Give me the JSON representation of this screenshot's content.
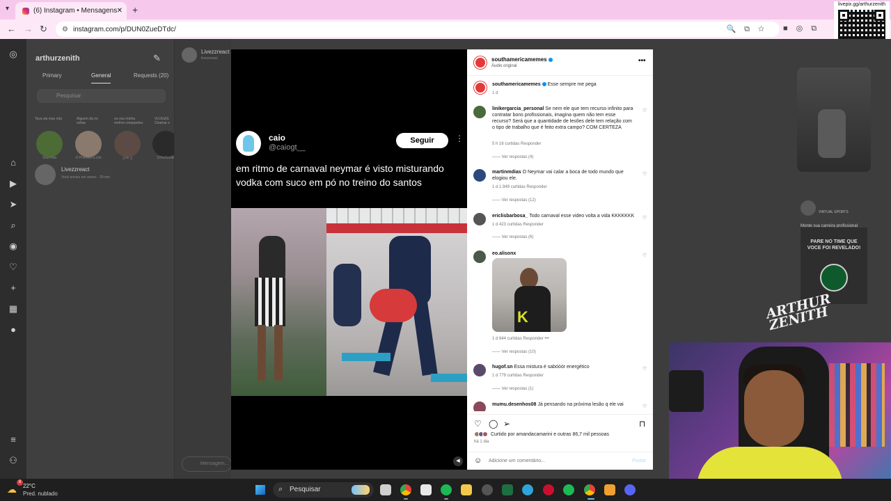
{
  "browser": {
    "tab_title": "(6) Instagram • Mensagens",
    "tab_close": "✕",
    "new_tab": "+",
    "url": "instagram.com/p/DUN0ZueDTdc/",
    "qr_caption": "livepix.gg/arthurzenith"
  },
  "dm_panel": {
    "username": "arthurzenith",
    "tabs": [
      "Primary",
      "General",
      "Requests (20)"
    ],
    "search_placeholder": "Pesquisar",
    "notes": [
      "Tava sla mas rola",
      "Alguem da mi voltas",
      "eu vou minha melhor companhia",
      "VLOGAS Chamar o"
    ],
    "story_labels": [
      "Sua nota",
      "O Primeiro a Uni",
      "ع‌ ﻋﺎﺩﻝ",
      "224aSeulle"
    ],
    "thread_name": "Livezzreact",
    "thread_preview": "Você enviou um anexo · 28 min"
  },
  "chat": {
    "name": "Livezzreact",
    "sub": "livezzreact",
    "message_placeholder": "Mensagem..."
  },
  "tweet": {
    "name": "caio",
    "handle": "@caiogt__",
    "follow": "Seguir",
    "text": "em ritmo de carnaval neymar é visto misturando vodka com suco em pó no treino do santos"
  },
  "post": {
    "author": "southamericamemes",
    "audio": "Áudio original",
    "caption": "Esse sempre me pega",
    "caption_time": "1 d",
    "comments": [
      {
        "user": "linikergarcia_personal",
        "text": "Se nem ele que tem recurso infinito para contratar bons profissionais, imagina quem não tem esse recurso? Será que a quantidade de lesões dele tem relação com o tipo de trabalho que é feito extra campo? COM CERTEZA",
        "meta": "5 h   16 curtidas   Responder",
        "replies": "Ver respostas (4)"
      },
      {
        "user": "martinmdias",
        "text": "O Neymar vai calar a boca de todo mundo que elogiou ele.",
        "meta": "1 d   1.949 curtidas   Responder",
        "replies": "Ver respostas (12)"
      },
      {
        "user": "ericlisbarbosa_",
        "text": "Todo carnaval esse video volta a vida KKKKKKK",
        "meta": "1 d   423 curtidas   Responder",
        "replies": "Ver respostas (6)"
      },
      {
        "user": "eo.alisonx",
        "text": "",
        "meta": "1 d   844 curtidas   Responder   •••",
        "replies": "Ver respostas (10)"
      },
      {
        "user": "hugof.sn",
        "text": "Essa mistura é sabóóór energético",
        "meta": "1 d   779 curtidas   Responder",
        "replies": "Ver respostas (1)"
      },
      {
        "user": "mumu.desenhos08",
        "text": "Já pensando na próxima lesão q ele vai",
        "meta": "",
        "replies": ""
      }
    ],
    "liked_by": "Curtido por amandacamarini e outras 86,7 mil pessoas",
    "posted_ago": "há 1 dia",
    "add_comment_placeholder": "Adicione um comentário...",
    "post_button": "Postar"
  },
  "sidebar_reels": {
    "caption": "Monte sua carreira profissional",
    "page_title": "VIRTUAL SPORTS",
    "promo_text": "PARE NO TIME QUE VOCE FOI REVELADO!"
  },
  "overlay": {
    "signature": "ARTHUR ZENITH"
  },
  "taskbar": {
    "temperature": "22°C",
    "weather": "Pred. nublado",
    "weather_badge": "8",
    "search_placeholder": "Pesquisar"
  }
}
